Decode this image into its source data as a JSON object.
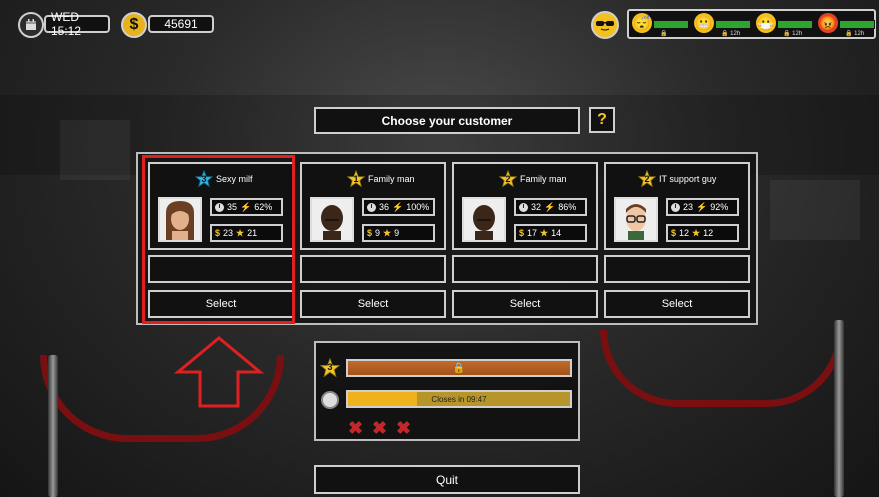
{
  "hud": {
    "day_time": "WED 15:12",
    "money": "45691",
    "currency_symbol": "$"
  },
  "mood_bar": {
    "player_icon": "sunglasses-face-icon",
    "entries": [
      {
        "icon": "sleepy-face-icon",
        "level": 0.9,
        "lock": true,
        "label": ""
      },
      {
        "icon": "grimace-face-icon",
        "level": 0.9,
        "lock": true,
        "label": "12h"
      },
      {
        "icon": "mask-face-icon",
        "level": 0.9,
        "lock": true,
        "label": "12h"
      },
      {
        "icon": "angry-face-icon",
        "level": 0.9,
        "lock": true,
        "label": "12h"
      }
    ]
  },
  "dialog": {
    "title": "Choose your customer",
    "help_label": "?"
  },
  "customers": [
    {
      "level": "3",
      "star_color": "#2ab7e8",
      "name": "Sexy milf",
      "time": "35",
      "satisfaction": "62%",
      "money": "23",
      "rating": "21",
      "select_label": "Select",
      "portrait": "woman-portrait",
      "highlighted": true
    },
    {
      "level": "1",
      "star_color": "#f0c52c",
      "name": "Family man",
      "time": "36",
      "satisfaction": "100%",
      "money": "9",
      "rating": "9",
      "select_label": "Select",
      "portrait": "man-portrait",
      "highlighted": false
    },
    {
      "level": "2",
      "star_color": "#f0c52c",
      "name": "Family man",
      "time": "32",
      "satisfaction": "86%",
      "money": "17",
      "rating": "14",
      "select_label": "Select",
      "portrait": "man-portrait",
      "highlighted": false
    },
    {
      "level": "2",
      "star_color": "#f0c52c",
      "name": "IT support guy",
      "time": "23",
      "satisfaction": "92%",
      "money": "12",
      "rating": "12",
      "select_label": "Select",
      "portrait": "glasses-man-portrait",
      "highlighted": false
    }
  ],
  "progress": {
    "level_star": "3",
    "level_fill": 1.0,
    "timer_text": "Closes in 09:47",
    "timer_fill": 0.31,
    "strikes": [
      "✖",
      "✖",
      "✖"
    ]
  },
  "quit_label": "Quit",
  "colors": {
    "accent_gold": "#f0c52c",
    "highlight_red": "#e02020",
    "strike_red": "#c4262c",
    "mood_green": "#2ea52e"
  }
}
